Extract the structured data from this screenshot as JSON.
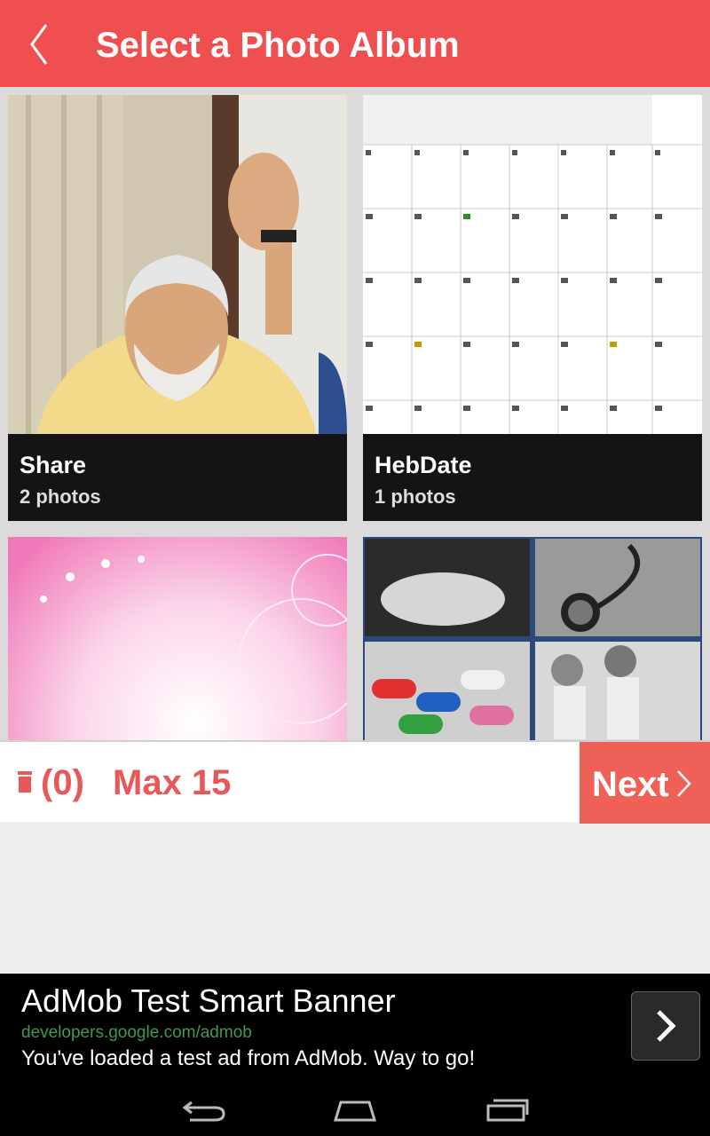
{
  "header": {
    "title": "Select a Photo Album"
  },
  "albums": [
    {
      "name": "Share",
      "count": "2 photos"
    },
    {
      "name": "HebDate",
      "count": "1 photos"
    }
  ],
  "bottom_bar": {
    "selected_count": "(0)",
    "max_label": "Max 15",
    "next_label": "Next"
  },
  "ad": {
    "title": "AdMob Test Smart Banner",
    "url": "developers.google.com/admob",
    "body": "You've loaded a test ad from AdMob. Way to go!"
  },
  "colors": {
    "accent": "#ef4f4f",
    "next_button": "#ef6057",
    "ad_url": "#3f9a4f"
  },
  "icons": [
    "back-chevron-icon",
    "trash-icon",
    "next-chevron-icon",
    "ad-arrow-icon",
    "nav-back-icon",
    "nav-home-icon",
    "nav-recents-icon"
  ]
}
